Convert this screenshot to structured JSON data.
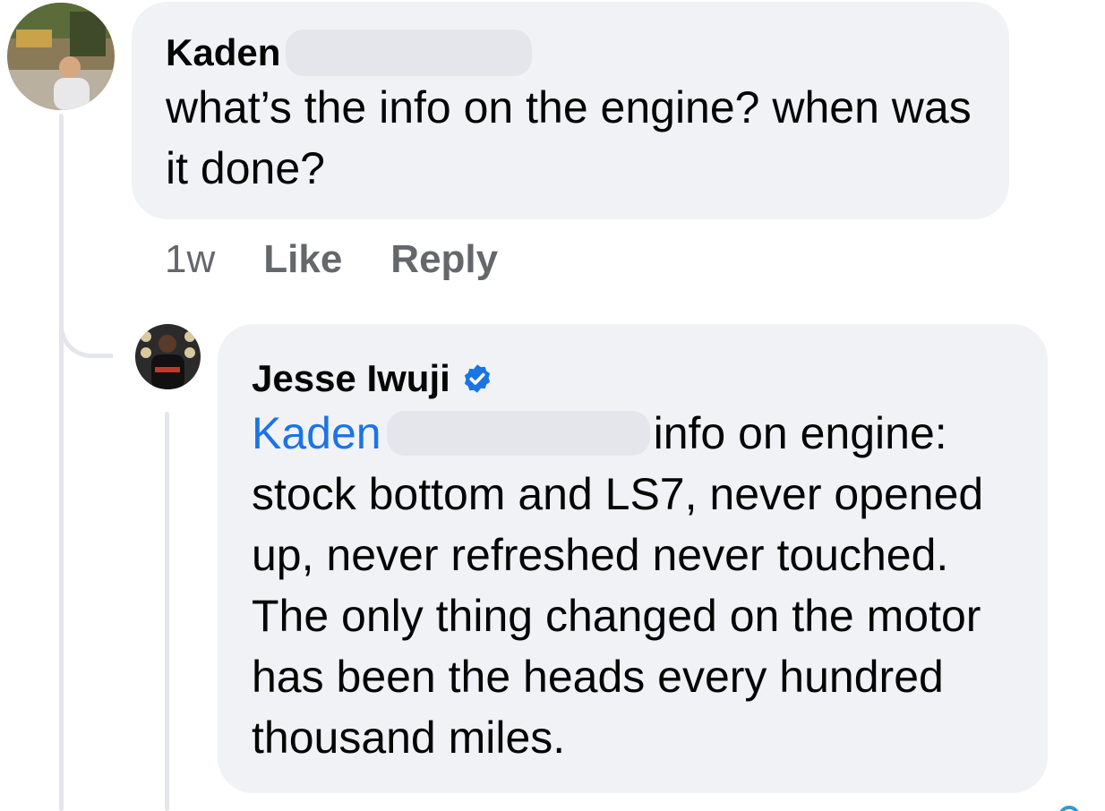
{
  "comment": {
    "author": "Kaden",
    "text": "what’s the info on the engine? when was it done?",
    "timestamp": "1w",
    "like_label": "Like",
    "reply_label": "Reply"
  },
  "reply": {
    "author": "Jesse Iwuji",
    "verified": true,
    "mention": "Kaden",
    "text": "info on engine: stock bottom and LS7, never opened up, never refreshed never touched. The only thing changed on the motor has been the heads every hundred thousand miles."
  },
  "colors": {
    "bubble": "#f0f2f5",
    "mention": "#1b74e4",
    "secondary_text": "#65676b",
    "verified_badge": "#1b74e4"
  },
  "icons": {
    "verified": "verified-badge-icon"
  }
}
